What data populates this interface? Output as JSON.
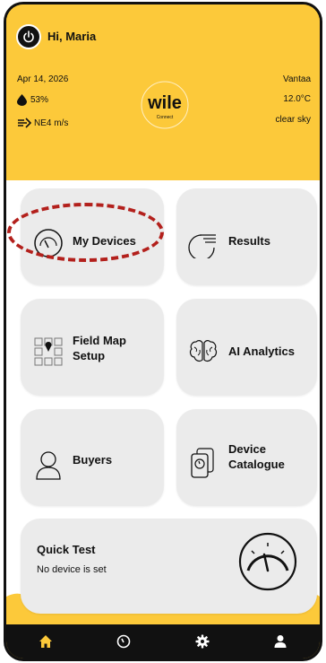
{
  "header": {
    "greeting": "Hi, Maria",
    "date": "Apr 14, 2026",
    "humidity": "53%",
    "wind": "NE4 m/s",
    "city": "Vantaa",
    "temperature": "12.0°C",
    "sky": "clear sky",
    "logo_text": "wile",
    "logo_subtext": "Connect"
  },
  "tiles": {
    "my_devices": "My Devices",
    "results": "Results",
    "field_map_1": "Field Map",
    "field_map_2": "Setup",
    "ai_analytics": "AI Analytics",
    "buyers": "Buyers",
    "device_catalogue_1": "Device",
    "device_catalogue_2": "Catalogue",
    "quick_test_title": "Quick Test",
    "quick_test_status": "No device is set"
  },
  "colors": {
    "brand_yellow": "#fcc93a",
    "tile_gray": "#ebebeb",
    "highlight_red": "#b3201c",
    "nav_active": "#fcc93a"
  },
  "nav": {
    "items": [
      "home-icon",
      "gauge-icon",
      "gear-icon",
      "user-icon"
    ]
  }
}
